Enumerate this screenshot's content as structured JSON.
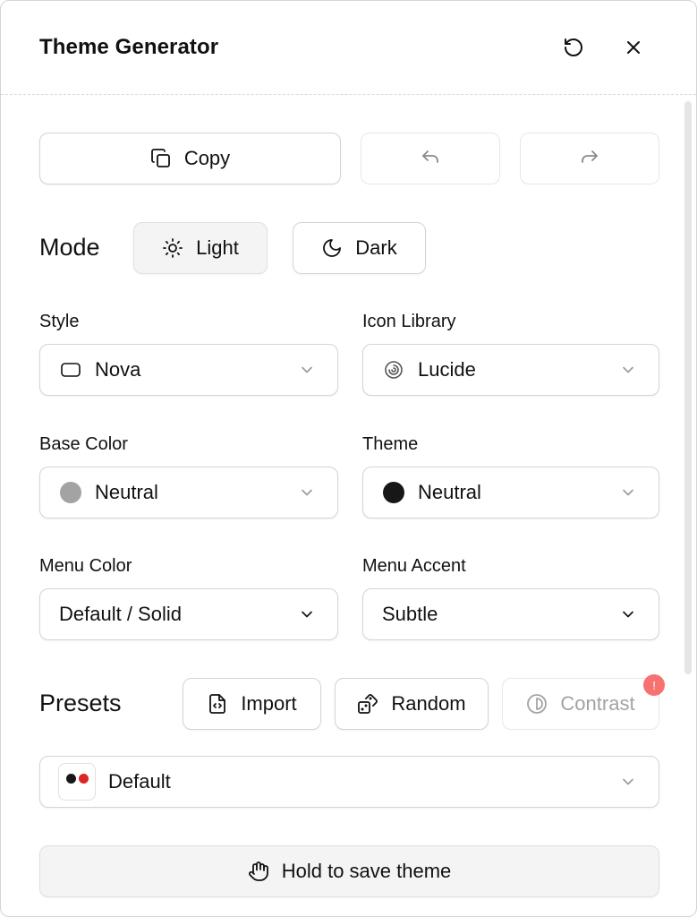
{
  "header": {
    "title": "Theme Generator",
    "reset_icon": "rotate-ccw-icon",
    "close_icon": "close-icon"
  },
  "toolbar": {
    "copy_label": "Copy",
    "copy_icon": "copy-icon",
    "undo_icon": "undo-icon",
    "redo_icon": "redo-icon"
  },
  "mode": {
    "label": "Mode",
    "light_label": "Light",
    "dark_label": "Dark",
    "selected": "Light"
  },
  "style": {
    "label": "Style",
    "value": "Nova",
    "icon": "rounded-rect-icon"
  },
  "icon_library": {
    "label": "Icon Library",
    "value": "Lucide",
    "icon": "lucide-logo-icon"
  },
  "base_color": {
    "label": "Base Color",
    "value": "Neutral",
    "swatch": "#a3a3a3"
  },
  "theme": {
    "label": "Theme",
    "value": "Neutral",
    "swatch": "#171717"
  },
  "menu_color": {
    "label": "Menu Color",
    "value": "Default / Solid"
  },
  "menu_accent": {
    "label": "Menu Accent",
    "value": "Subtle"
  },
  "presets": {
    "label": "Presets",
    "import_label": "Import",
    "random_label": "Random",
    "contrast_label": "Contrast",
    "contrast_badge": "!",
    "selected": "Default",
    "swatch_colors": [
      "#171717",
      "#dc2626"
    ]
  },
  "save": {
    "label": "Hold to save theme",
    "icon": "hand-icon"
  },
  "colors": {
    "border": "#d4d4d4",
    "badge": "#f87171",
    "muted_text": "#a3a3a3"
  }
}
